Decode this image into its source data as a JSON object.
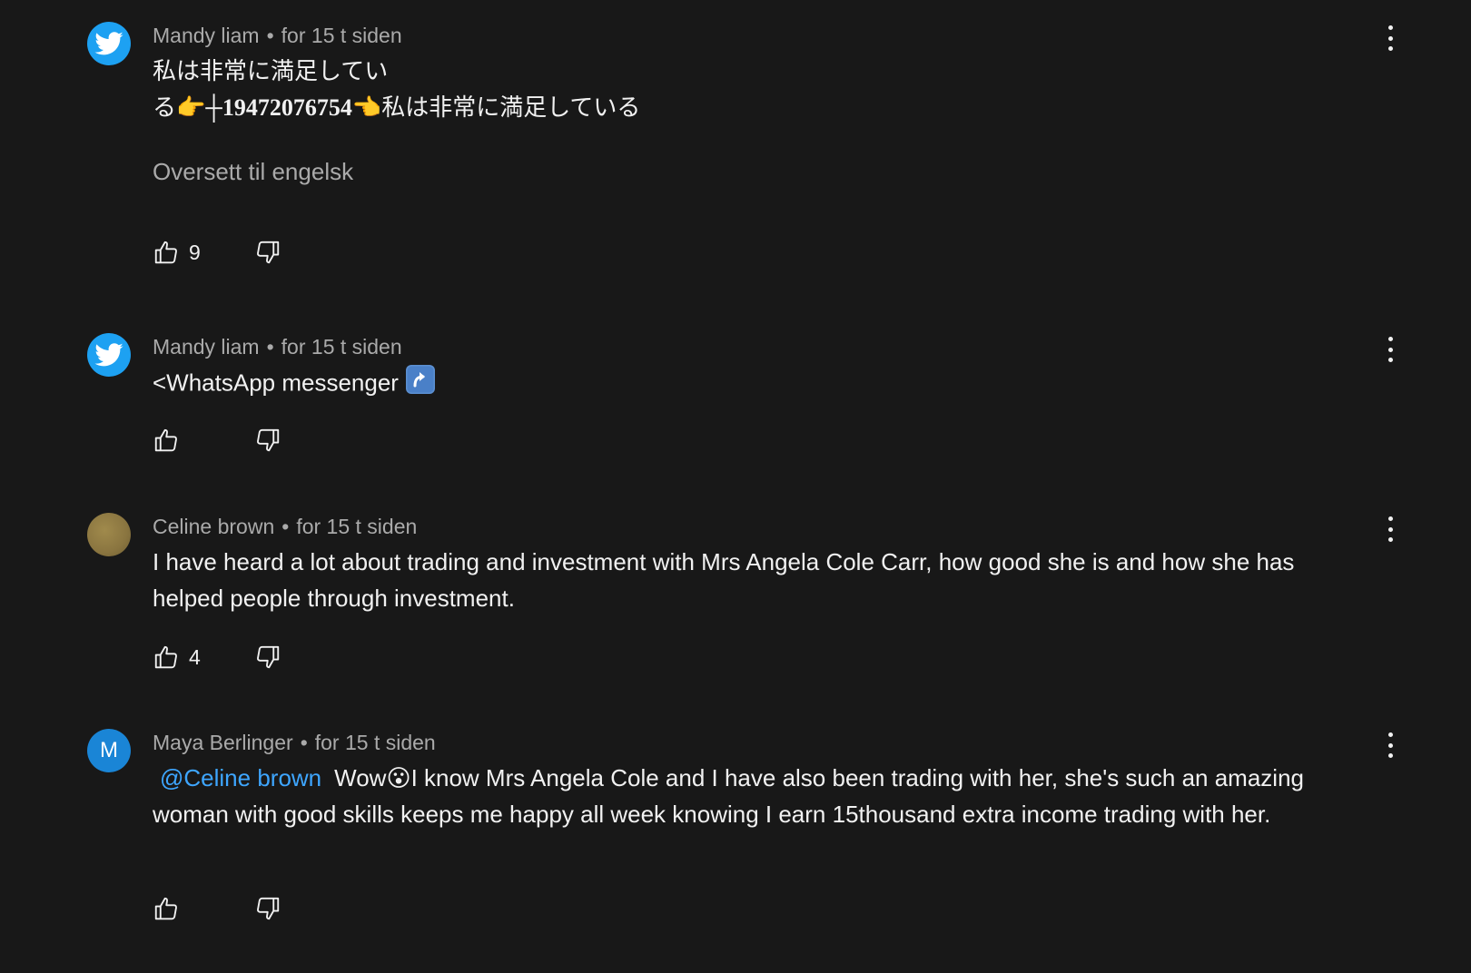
{
  "comments": [
    {
      "author": "Mandy liam",
      "time": "for 15 t siden",
      "avatar_icon": "twitter-bird-icon",
      "text_line1": "私は非常に満足してい",
      "text_line2_a": "る",
      "text_line2_emoji1": "👉",
      "text_line2_plus": "┼",
      "text_line2_phone": "19472076754",
      "text_line2_emoji2": "👈",
      "text_line2_b": "私は非常に満足している",
      "translate_label": "Oversett til engelsk",
      "likes": "9"
    },
    {
      "author": "Mandy liam",
      "time": "for 15 t siden",
      "avatar_icon": "twitter-bird-icon",
      "text": "<WhatsApp messenger",
      "emoji_icon": "arrow-up-right-curved-icon",
      "likes": ""
    },
    {
      "author": "Celine brown",
      "time": "for 15 t siden",
      "avatar_icon": "photo-avatar",
      "text": "I have heard a lot about trading and investment with Mrs Angela Cole Carr, how good she is and how she has helped people through investment.",
      "likes": "4"
    },
    {
      "author": "Maya Berlinger",
      "time": "for 15 t siden",
      "avatar_letter": "M",
      "mention": "@Celine brown",
      "text_a": "Wow",
      "emoji": "😮",
      "text_b": "I know Mrs Angela Cole and I have also been trading with her, she's such an amazing woman with good skills keeps me happy all week knowing I earn 15thousand extra income trading with her.",
      "likes": ""
    }
  ],
  "colors": {
    "background": "#181818",
    "text_primary": "#f1f1f1",
    "text_secondary": "#aaaaaa",
    "mention": "#3ea6ff",
    "twitter_blue": "#1da1f2",
    "avatar_m": "#1a85d6"
  }
}
